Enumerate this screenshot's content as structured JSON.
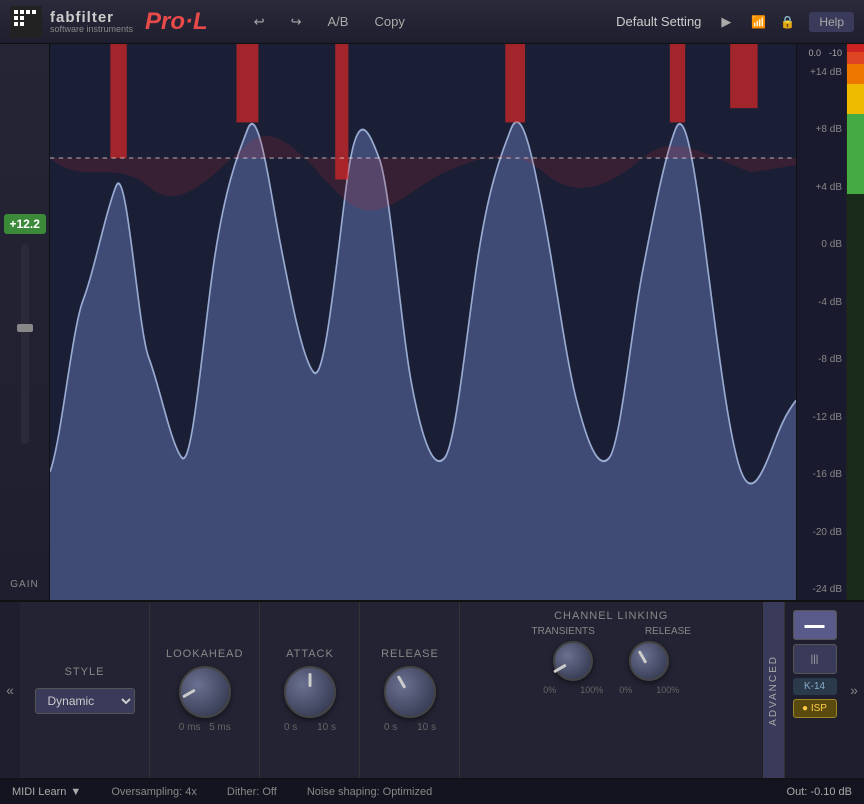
{
  "header": {
    "logo_sub": "software instruments",
    "logo_main": "Pro·L",
    "undo_label": "↩",
    "redo_label": "↪",
    "ab_label": "A/B",
    "copy_label": "Copy",
    "preset_name": "Default Setting",
    "play_label": "▶",
    "help_label": "Help"
  },
  "db_scale": {
    "labels": [
      "+14 dB",
      "+8 dB",
      "+4 dB",
      "0 dB",
      "-4 dB",
      "-8 dB",
      "-12 dB",
      "-16 dB",
      "-20 dB",
      "-24 dB"
    ]
  },
  "gain": {
    "value": "+12.2",
    "label": "GAIN"
  },
  "controls": {
    "nav_left": "«",
    "nav_right": "»",
    "style_label": "STYLE",
    "style_option": "Dynamic",
    "lookahead_label": "LOOKAHEAD",
    "lookahead_range": [
      "0 ms",
      "5 ms"
    ],
    "attack_label": "ATTACK",
    "attack_range": [
      "0 s",
      "10 s"
    ],
    "release_label": "RELEASE",
    "release_range": [
      "0 s",
      "10 s"
    ],
    "channel_label": "CHANNEL LINKING",
    "transients_label": "TRANSIENTS",
    "release_sub_label": "RELEASE",
    "transients_range": [
      "0%",
      "100%"
    ],
    "release2_range": [
      "0%",
      "100%"
    ],
    "advanced_label": "ADVANCED"
  },
  "right_panel": {
    "btn1_label": "▬▬",
    "btn2_label": "|||",
    "k14_label": "K-14",
    "isp_label": "● ISP"
  },
  "status_bar": {
    "midi_learn": "MIDI Learn",
    "dropdown_arrow": "▼",
    "oversampling": "Oversampling: 4x",
    "dither": "Dither: Off",
    "noise_shaping": "Noise shaping: Optimized",
    "out_label": "Out:",
    "out_value": "-0.10 dB"
  },
  "meter": {
    "top_values": [
      "0.0",
      "-10"
    ]
  }
}
